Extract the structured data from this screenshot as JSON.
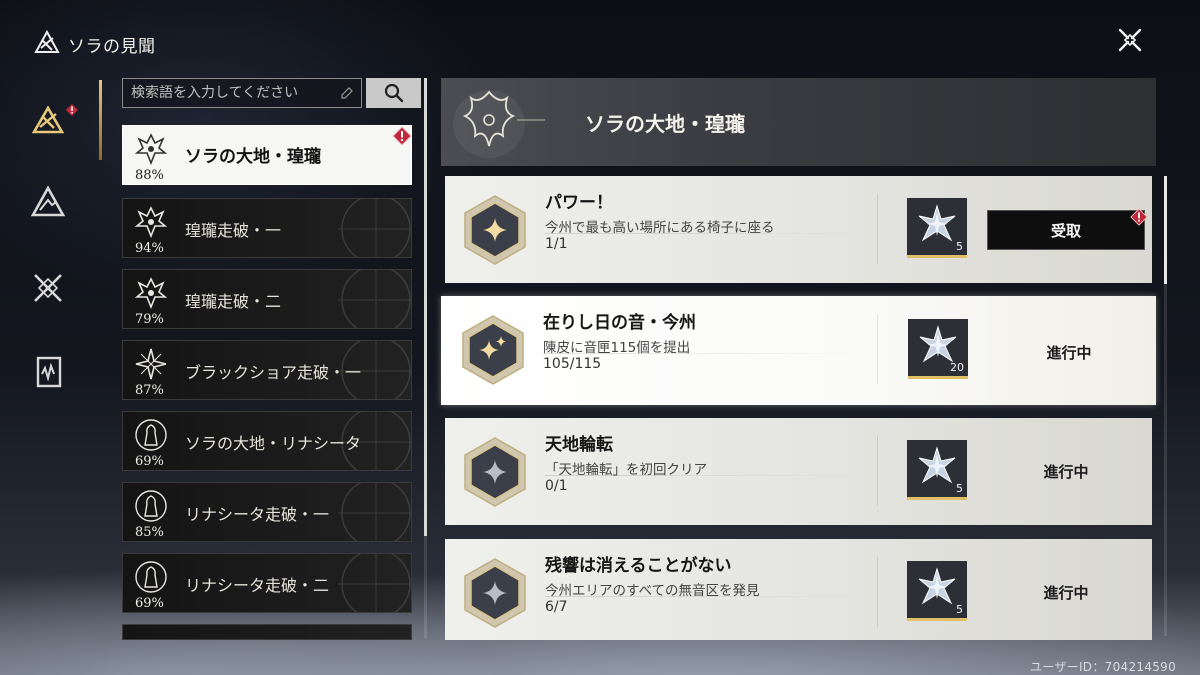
{
  "header": {
    "title": "ソラの見聞"
  },
  "search": {
    "placeholder": "検索語を入力してください"
  },
  "regions": [
    {
      "name": "ソラの大地・瑝瓏",
      "percent": "88%",
      "icon": "dragon-emblem-icon"
    },
    {
      "name": "瑝瓏走破・一",
      "percent": "94%",
      "icon": "dragon-emblem-icon"
    },
    {
      "name": "瑝瓏走破・二",
      "percent": "79%",
      "icon": "dragon-emblem-icon"
    },
    {
      "name": "ブラックショア走破・一",
      "percent": "87%",
      "icon": "flower-emblem-icon"
    },
    {
      "name": "ソラの大地・リナシータ",
      "percent": "69%",
      "icon": "statue-emblem-icon"
    },
    {
      "name": "リナシータ走破・一",
      "percent": "85%",
      "icon": "statue-emblem-icon"
    },
    {
      "name": "リナシータ走破・二",
      "percent": "69%",
      "icon": "statue-emblem-icon"
    }
  ],
  "selected_region": {
    "title": "ソラの大地・瑝瓏"
  },
  "achievements": [
    {
      "title": "パワー！",
      "description": "今州で最も高い場所にある椅子に座る",
      "progress": "1/1",
      "reward_count": "5",
      "status": "受取",
      "claimable": true
    },
    {
      "title": "在りし日の音・今州",
      "description": "陳皮に音匣115個を提出",
      "progress": "105/115",
      "reward_count": "20",
      "status": "進行中",
      "claimable": false
    },
    {
      "title": "天地輪転",
      "description": "「天地輪転」を初回クリア",
      "progress": "0/1",
      "reward_count": "5",
      "status": "進行中",
      "claimable": false
    },
    {
      "title": "残響は消えることがない",
      "description": "今州エリアのすべての無音区を発見",
      "progress": "6/7",
      "reward_count": "5",
      "status": "進行中",
      "claimable": false
    }
  ],
  "footer": {
    "user_id": "ユーザーID：704214590"
  },
  "colors": {
    "accent_gold": "#e0c066",
    "alert_red": "#c0283a",
    "selected_bg": "#f6f6f4"
  }
}
